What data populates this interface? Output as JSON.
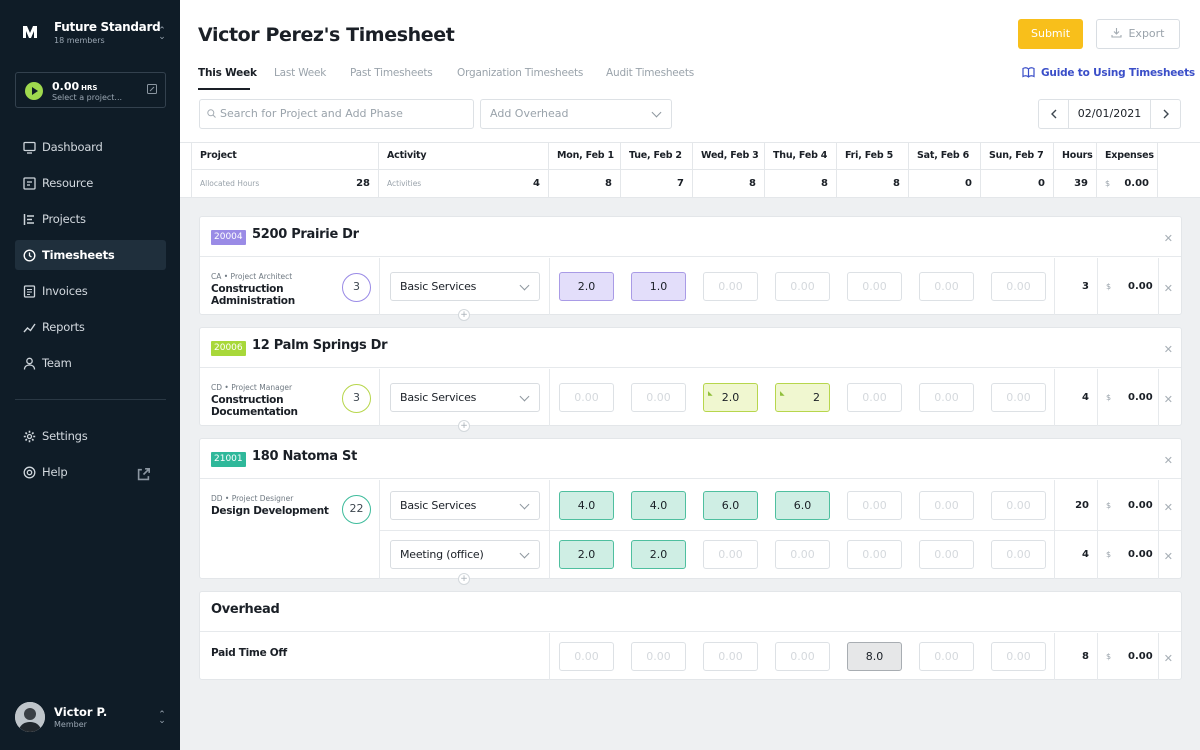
{
  "sidebar": {
    "org_name": "Future Standard",
    "org_members": "18 members",
    "timer": {
      "hours": "0.00",
      "unit": "HRS",
      "placeholder": "Select a project..."
    },
    "nav": [
      {
        "label": "Dashboard",
        "icon": "monitor-icon"
      },
      {
        "label": "Resource",
        "icon": "resource-icon"
      },
      {
        "label": "Projects",
        "icon": "projects-icon"
      },
      {
        "label": "Timesheets",
        "icon": "clock-icon",
        "active": true
      },
      {
        "label": "Invoices",
        "icon": "invoice-icon"
      },
      {
        "label": "Reports",
        "icon": "chart-icon"
      },
      {
        "label": "Team",
        "icon": "person-icon"
      }
    ],
    "bottom_nav": [
      {
        "label": "Settings",
        "icon": "gear-icon"
      },
      {
        "label": "Help",
        "icon": "help-icon"
      }
    ],
    "user": {
      "name": "Victor P.",
      "role": "Member"
    }
  },
  "header": {
    "title": "Victor Perez's Timesheet",
    "submit_label": "Submit",
    "export_label": "Export",
    "tabs": [
      "This Week",
      "Last Week",
      "Past Timesheets",
      "Organization Timesheets",
      "Audit Timesheets"
    ],
    "guide_label": "Guide to Using Timesheets",
    "search_placeholder": "Search for Project and Add Phase",
    "overhead_placeholder": "Add Overhead",
    "date": "02/01/2021"
  },
  "summary": {
    "headers": {
      "project": "Project",
      "activity": "Activity",
      "hours": "Hours",
      "expenses": "Expenses"
    },
    "days": [
      "Mon, Feb 1",
      "Tue, Feb 2",
      "Wed, Feb 3",
      "Thu, Feb 4",
      "Fri, Feb 5",
      "Sat, Feb 6",
      "Sun, Feb 7"
    ],
    "allocated_label": "Allocated Hours",
    "allocated_value": "28",
    "activities_label": "Activities",
    "activities_value": "4",
    "day_totals": [
      "8",
      "7",
      "8",
      "8",
      "8",
      "0",
      "0"
    ],
    "hours_total": "39",
    "currency": "$",
    "expenses_total": "0.00"
  },
  "projects": [
    {
      "code": "20004",
      "name": "5200 Prairie Dr",
      "color": "#9a8be6",
      "phases": [
        {
          "role": "CA • Project Architect",
          "name": "Construction Administration",
          "hours": "3",
          "ring": "#9a8be6",
          "rows": [
            {
              "activity": "Basic Services",
              "days": [
                "2.0",
                "1.0",
                "0.00",
                "0.00",
                "0.00",
                "0.00",
                "0.00"
              ],
              "total": "3",
              "expense": "0.00"
            }
          ]
        }
      ]
    },
    {
      "code": "20006",
      "name": "12 Palm Springs Dr",
      "color": "#a8d83a",
      "phases": [
        {
          "role": "CD • Project Manager",
          "name": "Construction Documentation",
          "hours": "3",
          "ring": "#b7d64c",
          "rows": [
            {
              "activity": "Basic Services",
              "days": [
                "0.00",
                "0.00",
                "2.0",
                "2",
                "0.00",
                "0.00",
                "0.00"
              ],
              "total": "4",
              "expense": "0.00"
            }
          ]
        }
      ]
    },
    {
      "code": "21001",
      "name": "180 Natoma St",
      "color": "#2fb89a",
      "phases": [
        {
          "role": "DD • Project Designer",
          "name": "Design Development",
          "hours": "22",
          "ring": "#3fbc9c",
          "rows": [
            {
              "activity": "Basic Services",
              "days": [
                "4.0",
                "4.0",
                "6.0",
                "6.0",
                "0.00",
                "0.00",
                "0.00"
              ],
              "total": "20",
              "expense": "0.00"
            },
            {
              "activity": "Meeting (office)",
              "days": [
                "2.0",
                "2.0",
                "0.00",
                "0.00",
                "0.00",
                "0.00",
                "0.00"
              ],
              "total": "4",
              "expense": "0.00"
            }
          ]
        }
      ]
    }
  ],
  "overhead": {
    "title": "Overhead",
    "items": [
      {
        "name": "Paid Time Off",
        "days": [
          "0.00",
          "0.00",
          "0.00",
          "0.00",
          "8.0",
          "0.00",
          "0.00"
        ],
        "total": "8",
        "expense": "0.00"
      }
    ]
  },
  "colors": {
    "sidebar_bg": "#0f1c27",
    "accent_submit": "#f8bf1b",
    "link_blue": "#3a4ec8",
    "purple_fill": "#e3defa",
    "lime_fill": "#f0f7d0",
    "teal_fill": "#cfeee4",
    "grey_fill": "#e6e7e8"
  }
}
